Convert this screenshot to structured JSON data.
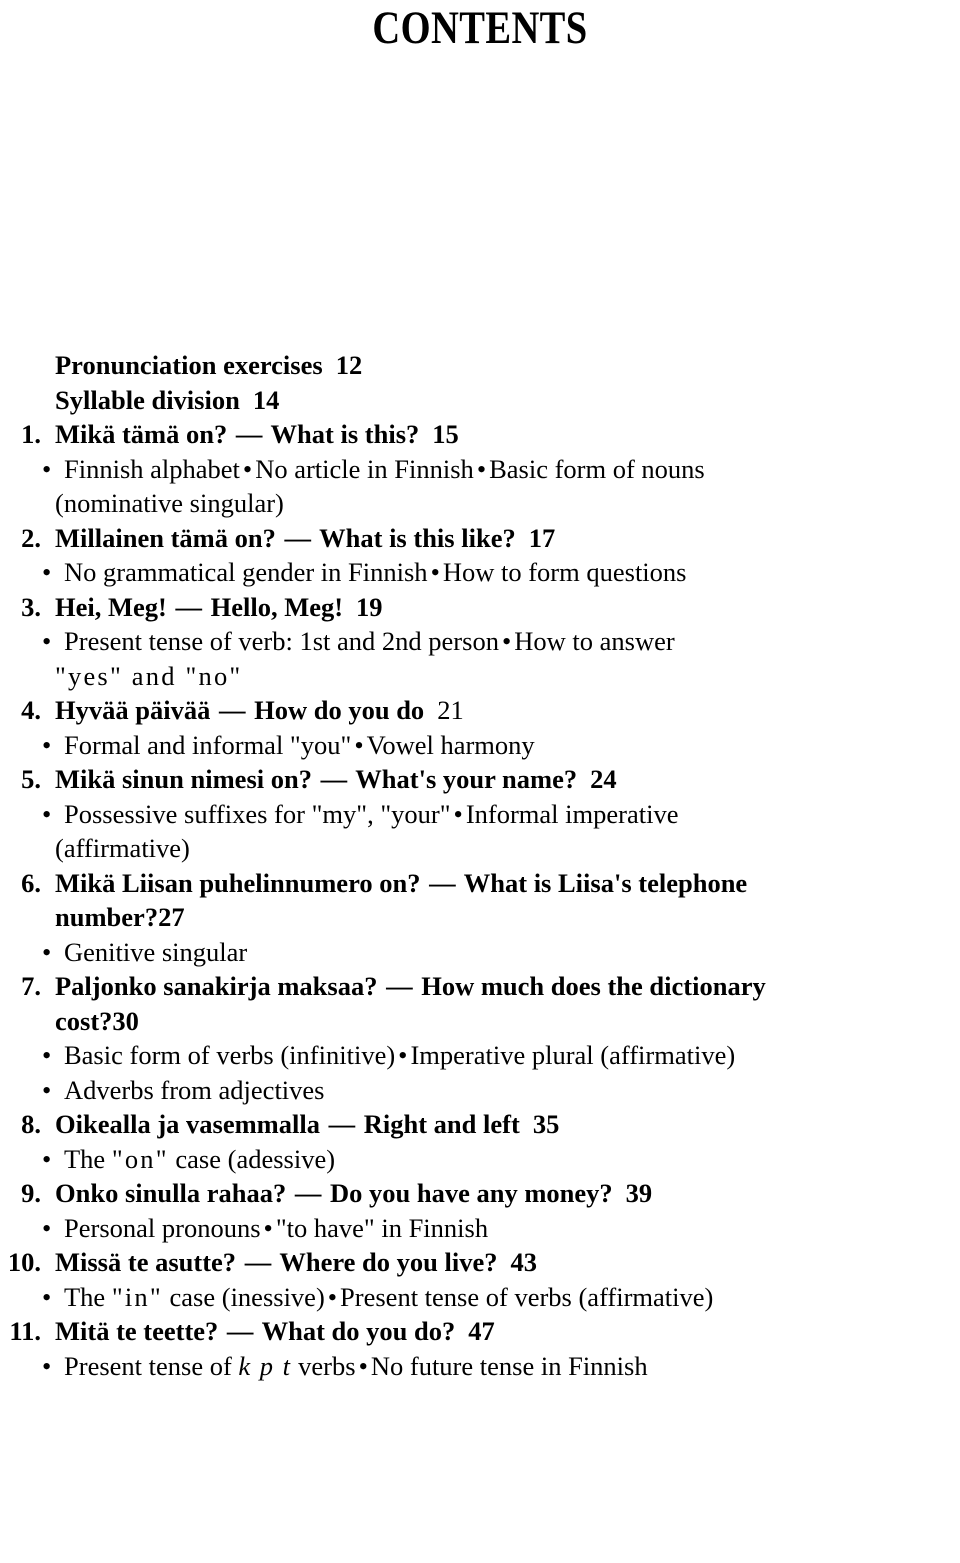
{
  "document": {
    "title": "CONTENTS"
  },
  "toc": {
    "entries": [
      {
        "number": "",
        "heading": "Pronunciation exercises",
        "page": "12",
        "page_bold": true,
        "subs": []
      },
      {
        "number": "",
        "heading": "Syllable division",
        "page": "14",
        "page_bold": true,
        "subs": []
      },
      {
        "number": "1.",
        "heading_fi": "Mikä tämä on?",
        "heading_en": "What is this?",
        "page": "15",
        "page_bold": true,
        "subs": [
          "Finnish alphabet",
          "No article in Finnish",
          "Basic form of nouns"
        ],
        "sub_cont": "(nominative singular)"
      },
      {
        "number": "2.",
        "heading_fi": "Millainen tämä on?",
        "heading_en": "What is this like?",
        "page": "17",
        "page_bold": true,
        "subs": [
          "No grammatical gender in Finnish",
          "How to form questions"
        ]
      },
      {
        "number": "3.",
        "heading_fi": "Hei, Meg!",
        "heading_en": "Hello, Meg!",
        "page": "19",
        "page_bold": true,
        "subs": [
          "Present tense of verb:  1st and 2nd person",
          "How to answer"
        ],
        "sub_cont": "\"yes\" and \"no\""
      },
      {
        "number": "4.",
        "heading_fi": "Hyvää päivää",
        "heading_en": "How do you do",
        "page": "21",
        "page_bold": false,
        "subs": [
          "Formal and informal \"you\"",
          "Vowel harmony"
        ]
      },
      {
        "number": "5.",
        "heading_fi": "Mikä sinun nimesi on?",
        "heading_en": "What's your name?",
        "page": "24",
        "page_bold": true,
        "subs": [
          "Possessive suffixes for \"my\", \"your\"",
          "Informal imperative"
        ],
        "sub_cont": "(affirmative)"
      },
      {
        "number": "6.",
        "heading_fi": "Mikä Liisan puhelinnumero on?",
        "heading_en": "What is Liisa's telephone",
        "heading_wrap": "number?",
        "page": "27",
        "page_bold": true,
        "subs": [
          "Genitive singular"
        ]
      },
      {
        "number": "7.",
        "heading_fi": "Paljonko sanakirja maksaa?",
        "heading_en": "How much does the dictionary",
        "heading_wrap": "cost?",
        "page": "30",
        "page_bold": true,
        "subs": [
          "Basic form of verbs (infinitive)",
          "Imperative plural (affirmative)",
          "Adverbs from adjectives"
        ]
      },
      {
        "number": "8.",
        "heading_fi": "Oikealla ja vasemmalla",
        "heading_en": "Right and left",
        "page": "35",
        "page_bold": true,
        "subs": [
          "The \"on\" case (adessive)"
        ]
      },
      {
        "number": "9.",
        "heading_fi": "Onko sinulla rahaa?",
        "heading_en": "Do you have any money?",
        "page": "39",
        "page_bold": true,
        "subs": [
          "Personal pronouns",
          "\"to have\" in Finnish"
        ]
      },
      {
        "number": "10.",
        "heading_fi": "Missä te asutte?",
        "heading_en": "Where do you live?",
        "page": "43",
        "page_bold": true,
        "subs": [
          "The \"in\" case (inessive)",
          "Present tense of verbs (affirmative)"
        ]
      },
      {
        "number": "11.",
        "heading_fi": "Mitä te teette?",
        "heading_en": "What do you do?",
        "page": "47",
        "page_bold": true,
        "subs": [
          "Present tense of k p t verbs",
          "No future tense in Finnish"
        ]
      }
    ],
    "glyphs": {
      "bullet": "•",
      "em_dash": "—"
    }
  }
}
